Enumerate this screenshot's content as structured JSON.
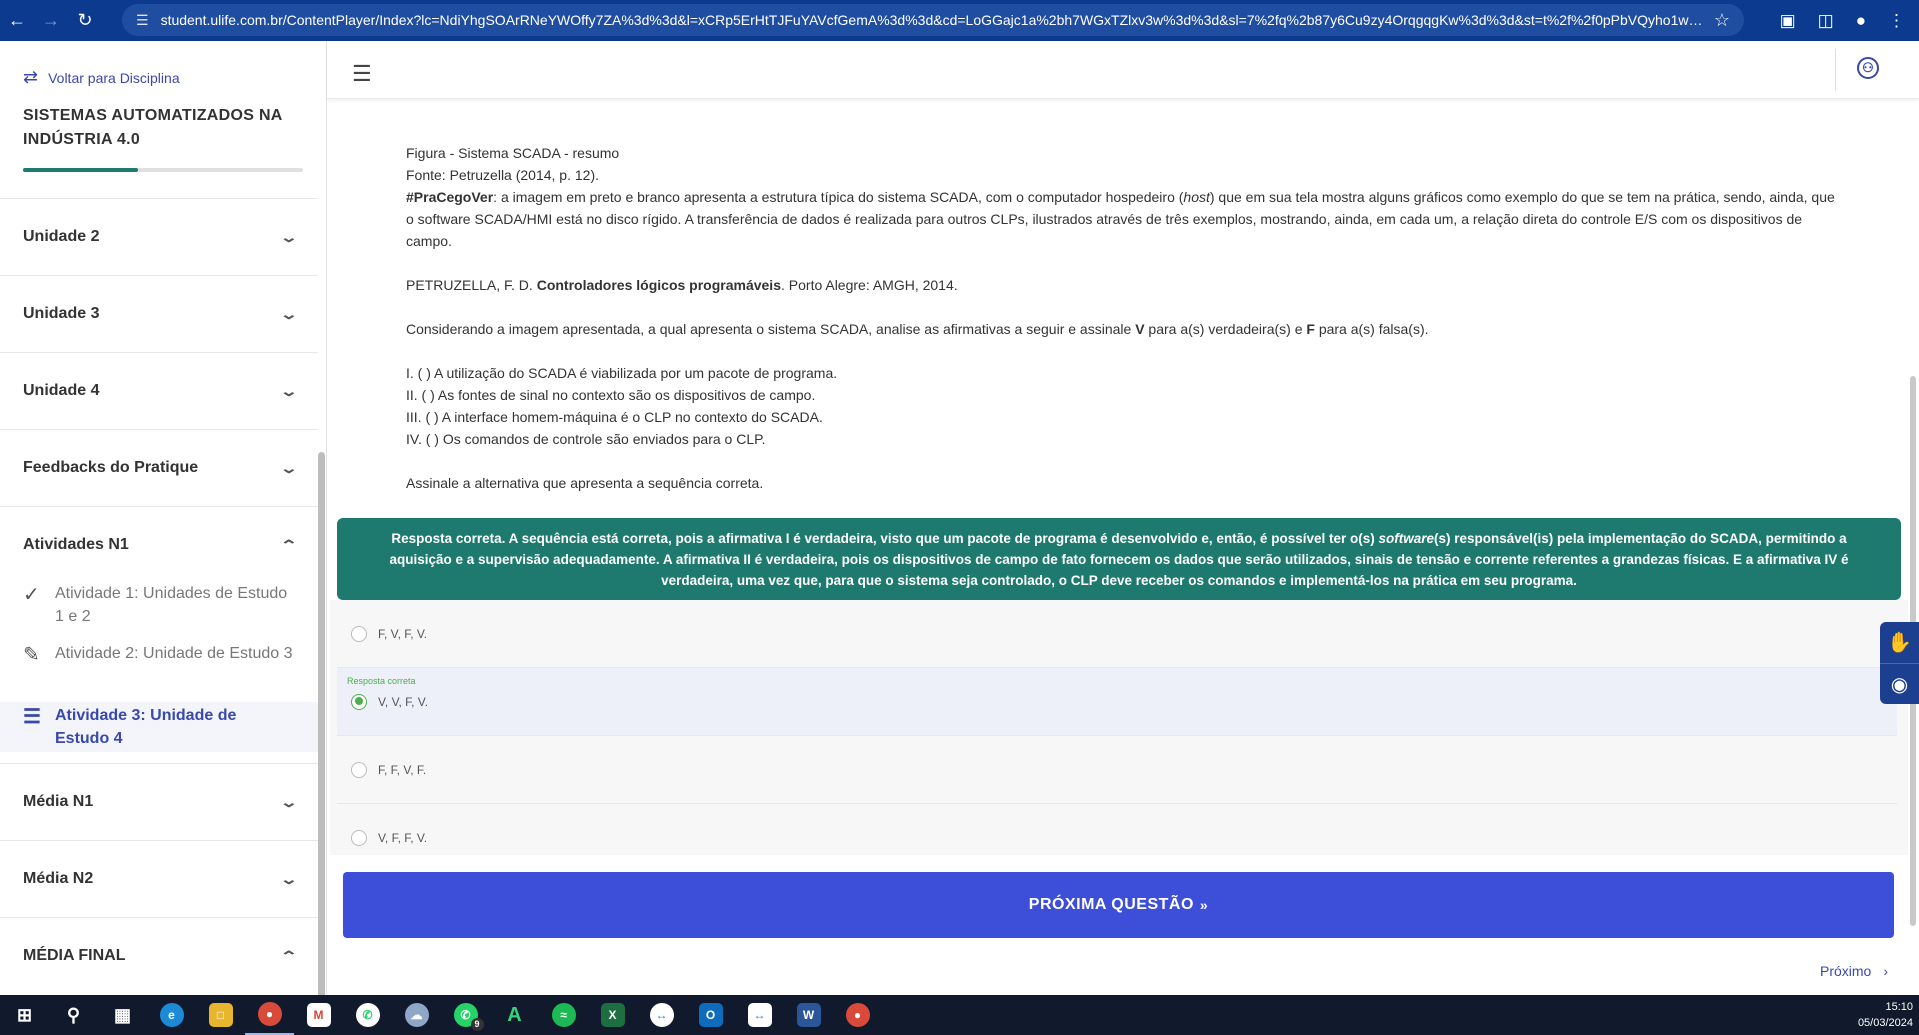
{
  "browser": {
    "url": "student.ulife.com.br/ContentPlayer/Index?lc=NdiYhgSOArRNeYWOffy7ZA%3d%3d&l=xCRp5ErHtTJFuYAVcfGemA%3d%3d&cd=LoGGajc1a%2bh7WGxTZlxv3w%3d%3d&sl=7%2fq%2b87y6Cu9zy4OrqgqgKw%3d%3d&st=t%2f%2f0pPbVQyho1wVNC9z..."
  },
  "sidebar": {
    "back_label": "Voltar para Disciplina",
    "course_title": "SISTEMAS AUTOMATIZADOS NA INDÚSTRIA 4.0",
    "progress_percent": 41,
    "items": [
      {
        "label": "Unidade 2",
        "expanded": false
      },
      {
        "label": "Unidade 3",
        "expanded": false
      },
      {
        "label": "Unidade 4",
        "expanded": false
      },
      {
        "label": "Feedbacks do Pratique",
        "expanded": false
      },
      {
        "label": "Atividades N1",
        "expanded": true
      },
      {
        "label": "Média N1",
        "expanded": false
      },
      {
        "label": "Média N2",
        "expanded": false
      },
      {
        "label": "MÉDIA FINAL",
        "expanded": true
      }
    ],
    "sub_items": [
      {
        "label": "Atividade 1: Unidades de Estudo 1 e 2",
        "icon": "check-icon"
      },
      {
        "label": "Atividade 2: Unidade de Estudo 3",
        "icon": "edit-link-icon"
      },
      {
        "label": "Atividade 3: Unidade de Estudo 4",
        "icon": "list-icon",
        "active": true
      }
    ]
  },
  "content": {
    "figure_caption": "Figura - Sistema SCADA - resumo",
    "source": "Fonte: Petruzella (2014, p. 12).",
    "alt_tag": "#PraCegoVer",
    "alt_text_1": ": a imagem em preto e branco apresenta a estrutura típica do sistema SCADA, com o computador hospedeiro (",
    "alt_host": "host",
    "alt_text_2": ") que em sua tela mostra alguns gráficos como exemplo do que se tem na prática, sendo, ainda, que o software SCADA/HMI está no disco rígido. A transferência de dados é realizada para outros CLPs, ilustrados através de três exemplos, mostrando, ainda, em cada um, a relação direta do controle E/S com os dispositivos de campo.",
    "ref_author": "PETRUZELLA, F. D. ",
    "ref_title": "Controladores lógicos programáveis",
    "ref_rest": ". Porto Alegre: AMGH, 2014.",
    "instr_1": "Considerando a imagem apresentada, a qual apresenta o sistema SCADA, analise as afirmativas a seguir e assinale ",
    "instr_v": "V",
    "instr_2": " para a(s) verdadeira(s) e ",
    "instr_f": "F",
    "instr_3": " para a(s) falsa(s).",
    "statements": [
      "I. (   ) A utilização do SCADA é viabilizada por um pacote de programa.",
      "II. (   ) As fontes de sinal no contexto são os dispositivos de campo.",
      "III. (  ) A interface homem-máquina é o CLP no contexto do SCADA.",
      "IV. (  ) Os comandos de controle são enviados para o CLP."
    ],
    "question": "Assinale a alternativa que apresenta a sequência correta."
  },
  "feedback": {
    "part1": "Resposta correta. A sequência está correta, pois a afirmativa I é verdadeira, visto que um pacote de programa é desenvolvido e, então, é possível ter o(s) ",
    "software": "software",
    "part2": "(s) responsável(is) pela implementação do SCADA, permitindo a aquisição e a supervisão adequadamente. A afirmativa II é verdadeira, pois os dispositivos de campo de fato fornecem os dados que serão utilizados, sinais de tensão e corrente referentes a grandezas físicas. E a afirmativa IV é verdadeira, uma vez que, para que o sistema seja controlado, o CLP deve receber os comandos e implementá-los na prática em seu programa."
  },
  "options": [
    {
      "label": "F, V, F, V.",
      "selected": false
    },
    {
      "label": "V, V, F, V.",
      "selected": true,
      "tag": "Resposta correta"
    },
    {
      "label": "F, F, V, F.",
      "selected": false
    },
    {
      "label": "V, F, F, V.",
      "selected": false
    }
  ],
  "next_button": "PRÓXIMA QUESTÃO",
  "footer_next": "Próximo",
  "taskbar": {
    "time": "15:10",
    "date": "05/03/2024",
    "whatsapp_badge": "9"
  },
  "colors": {
    "brand": "#0b3a8f",
    "accent": "#3949ab",
    "feedback": "#1e7a6e",
    "button": "#3d4ed8",
    "correct": "#4caf50"
  }
}
